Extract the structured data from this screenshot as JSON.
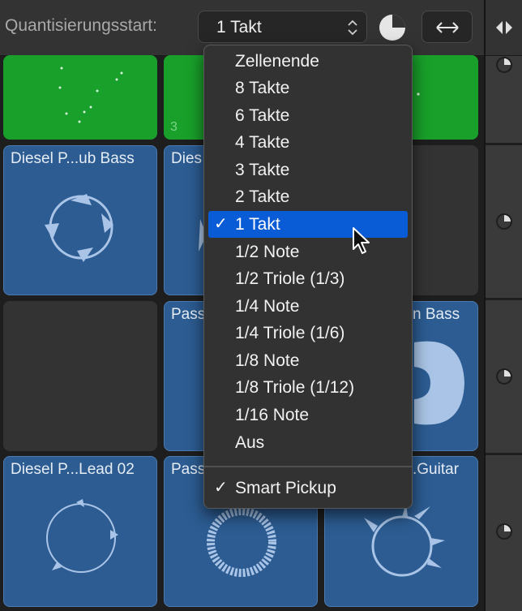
{
  "toolbar": {
    "label": "Quantisierungsstart:",
    "popup_value": "1 Takt"
  },
  "cells": [
    {
      "title": "",
      "number": ""
    },
    {
      "title": "",
      "number": "3"
    },
    {
      "title": "",
      "number": ""
    },
    {
      "title": "Diesel P...ub Bass"
    },
    {
      "title": "Dies"
    },
    {
      "title": "Pass"
    },
    {
      "title": "n Bass"
    },
    {
      "title": "Diesel P...Lead 02"
    },
    {
      "title": "Pass"
    },
    {
      "title": ".Guitar"
    }
  ],
  "menu": {
    "items": [
      {
        "label": "Zellenende",
        "checked": false
      },
      {
        "label": "8 Takte",
        "checked": false
      },
      {
        "label": "6 Takte",
        "checked": false
      },
      {
        "label": "4 Takte",
        "checked": false
      },
      {
        "label": "3 Takte",
        "checked": false
      },
      {
        "label": "2 Takte",
        "checked": false
      },
      {
        "label": "1 Takt",
        "checked": true
      },
      {
        "label": "1/2 Note",
        "checked": false
      },
      {
        "label": "1/2 Triole (1/3)",
        "checked": false
      },
      {
        "label": "1/4 Note",
        "checked": false
      },
      {
        "label": "1/4 Triole (1/6)",
        "checked": false
      },
      {
        "label": "1/8 Note",
        "checked": false
      },
      {
        "label": "1/8 Triole (1/12)",
        "checked": false
      },
      {
        "label": "1/16 Note",
        "checked": false
      },
      {
        "label": "Aus",
        "checked": false
      }
    ],
    "smart_pickup": {
      "label": "Smart Pickup",
      "checked": true
    },
    "check_glyph": "✓"
  },
  "colors": {
    "selection": "#0a5bd6",
    "cell_blue": "#2c5c92",
    "cell_green": "#19a02a"
  }
}
